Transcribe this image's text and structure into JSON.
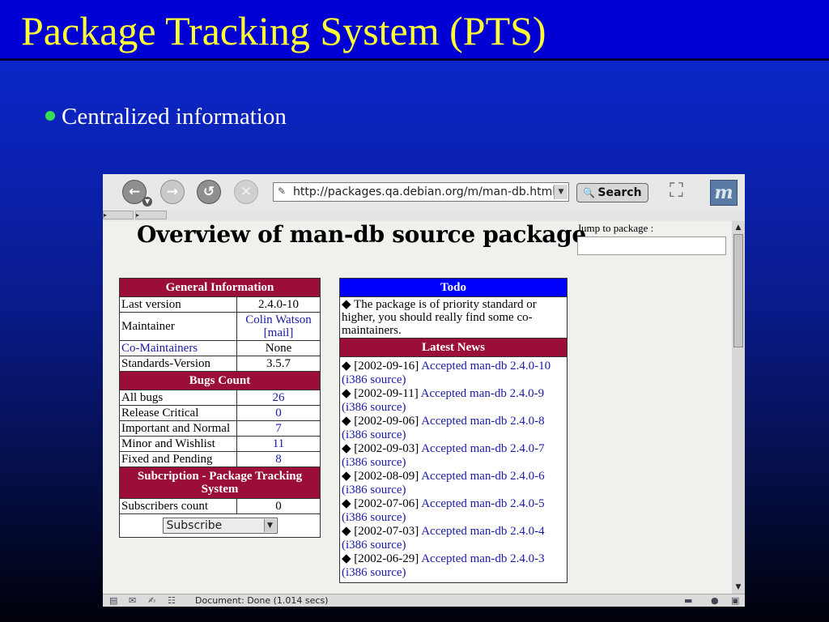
{
  "slide": {
    "title": "Package Tracking System (PTS)",
    "bullet": "Centralized information"
  },
  "browser": {
    "url": "http://packages.qa.debian.org/m/man-db.html",
    "search_label": "Search",
    "status": "Document: Done (1.014 secs)",
    "logo_glyph": "m"
  },
  "page": {
    "heading": "Overview of man-db source package",
    "jump_label": "Jump to package :",
    "general": {
      "header": "General Information",
      "rows": [
        {
          "label": "Last version",
          "value": "2.4.0-10"
        },
        {
          "label": "Maintainer",
          "value": "Colin Watson",
          "extra": "[mail]"
        },
        {
          "label": "Co-Maintainers",
          "value": "None"
        },
        {
          "label": "Standards-Version",
          "value": "3.5.7"
        }
      ]
    },
    "bugs": {
      "header": "Bugs Count",
      "rows": [
        {
          "label": "All bugs",
          "value": "26"
        },
        {
          "label": "Release Critical",
          "value": "0"
        },
        {
          "label": "Important and Normal",
          "value": "7"
        },
        {
          "label": "Minor and Wishlist",
          "value": "11"
        },
        {
          "label": "Fixed and Pending",
          "value": "8"
        }
      ]
    },
    "subscription": {
      "header": "Subcription - Package Tracking System",
      "count_label": "Subscribers count",
      "count_value": "0",
      "select_value": "Subscribe"
    },
    "todo": {
      "header": "Todo",
      "text": "The package is of priority standard or higher, you should really find some co-maintainers."
    },
    "news": {
      "header": "Latest News",
      "items": [
        {
          "date": "[2002-09-16]",
          "title": "Accepted man-db 2.4.0-10",
          "source": "(i386 source)"
        },
        {
          "date": "[2002-09-11]",
          "title": "Accepted man-db 2.4.0-9",
          "source": "(i386 source)"
        },
        {
          "date": "[2002-09-06]",
          "title": "Accepted man-db 2.4.0-8",
          "source": "(i386 source)"
        },
        {
          "date": "[2002-09-03]",
          "title": "Accepted man-db 2.4.0-7",
          "source": "(i386 source)"
        },
        {
          "date": "[2002-08-09]",
          "title": "Accepted man-db 2.4.0-6",
          "source": "(i386 source)"
        },
        {
          "date": "[2002-07-06]",
          "title": "Accepted man-db 2.4.0-5",
          "source": "(i386 source)"
        },
        {
          "date": "[2002-07-03]",
          "title": "Accepted man-db 2.4.0-4",
          "source": "(i386 source)"
        },
        {
          "date": "[2002-06-29]",
          "title": "Accepted man-db 2.4.0-3",
          "source": "(i386 source)"
        }
      ]
    }
  },
  "colors": {
    "slide_title": "#ffff33",
    "table_header": "#9a0e38",
    "todo_header": "#0000ff",
    "link": "#1a1aa6",
    "bullet": "#33dd55"
  }
}
